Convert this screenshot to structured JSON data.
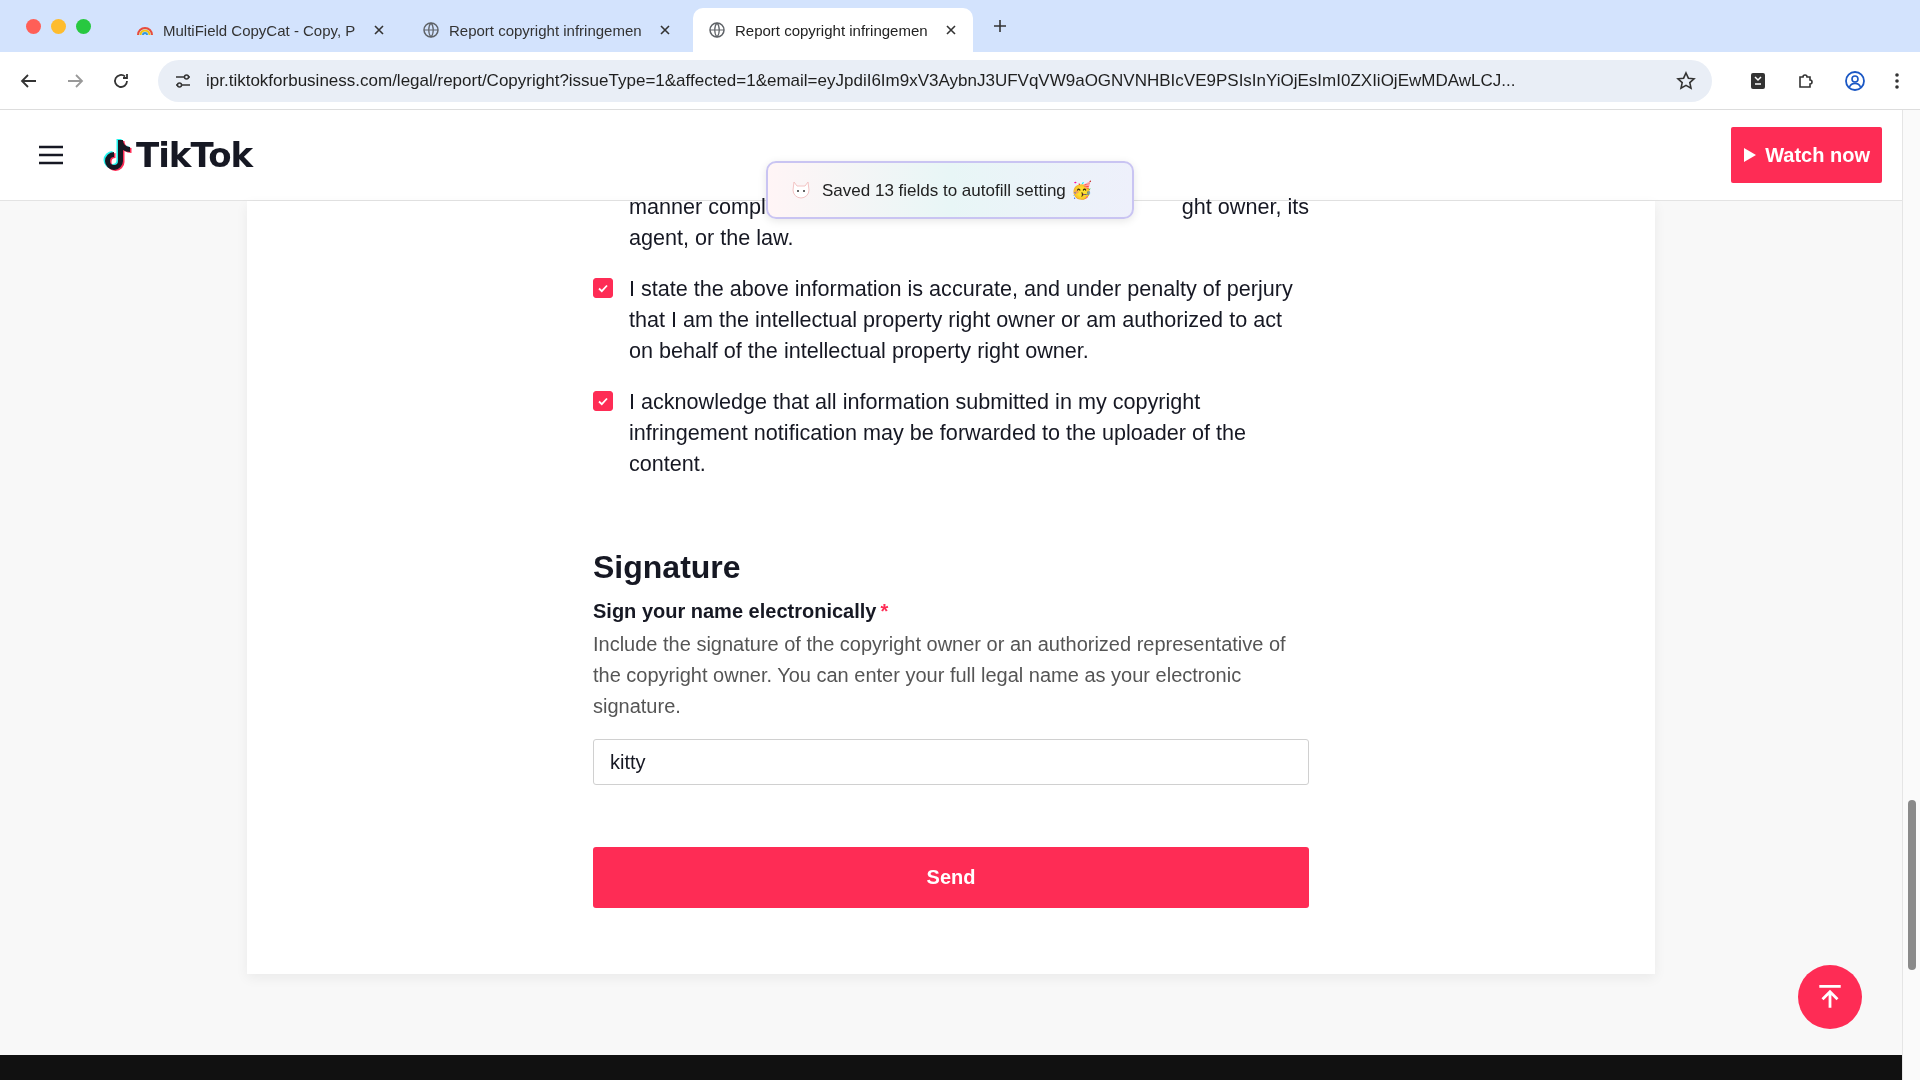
{
  "browser": {
    "tabs": [
      {
        "title": "MultiField CopyCat - Copy, P",
        "kind": "extension",
        "selected": false
      },
      {
        "title": "Report copyright infringemen",
        "kind": "web",
        "selected": false
      },
      {
        "title": "Report copyright infringemen",
        "kind": "web",
        "selected": true
      }
    ],
    "url": "ipr.tiktokforbusiness.com/legal/report/Copyright?issueType=1&affected=1&email=eyJpdiI6Im9xV3AybnJ3UFVqVW9aOGNVNHBIcVE9PSIsInYiOjEsImI0ZXIiOjEwMDAwLCJ..."
  },
  "header": {
    "logo": "TikTok",
    "watch_button": "Watch now"
  },
  "toast": {
    "text": "Saved 13 fields to autofill setting 🥳"
  },
  "partial_text": {
    "line_1_left": "manner compl",
    "line_1_right": "ght owner, its",
    "line_2": "agent, or the law."
  },
  "statements": [
    {
      "text": "I state the above information is accurate, and under penalty of perjury that I am the intellectual property right owner or am authorized to act on behalf of the intellectual property right owner.",
      "checked": true
    },
    {
      "text": "I acknowledge that all information submitted in my copyright infringement notification may be forwarded to the uploader of the content.",
      "checked": true
    }
  ],
  "signature": {
    "heading": "Signature",
    "label": "Sign your name electronically",
    "required_mark": "*",
    "description": "Include the signature of the copyright owner or an authorized representative of the copyright owner. You can enter your full legal name as your electronic signature.",
    "value": "kitty"
  },
  "send_button": "Send"
}
